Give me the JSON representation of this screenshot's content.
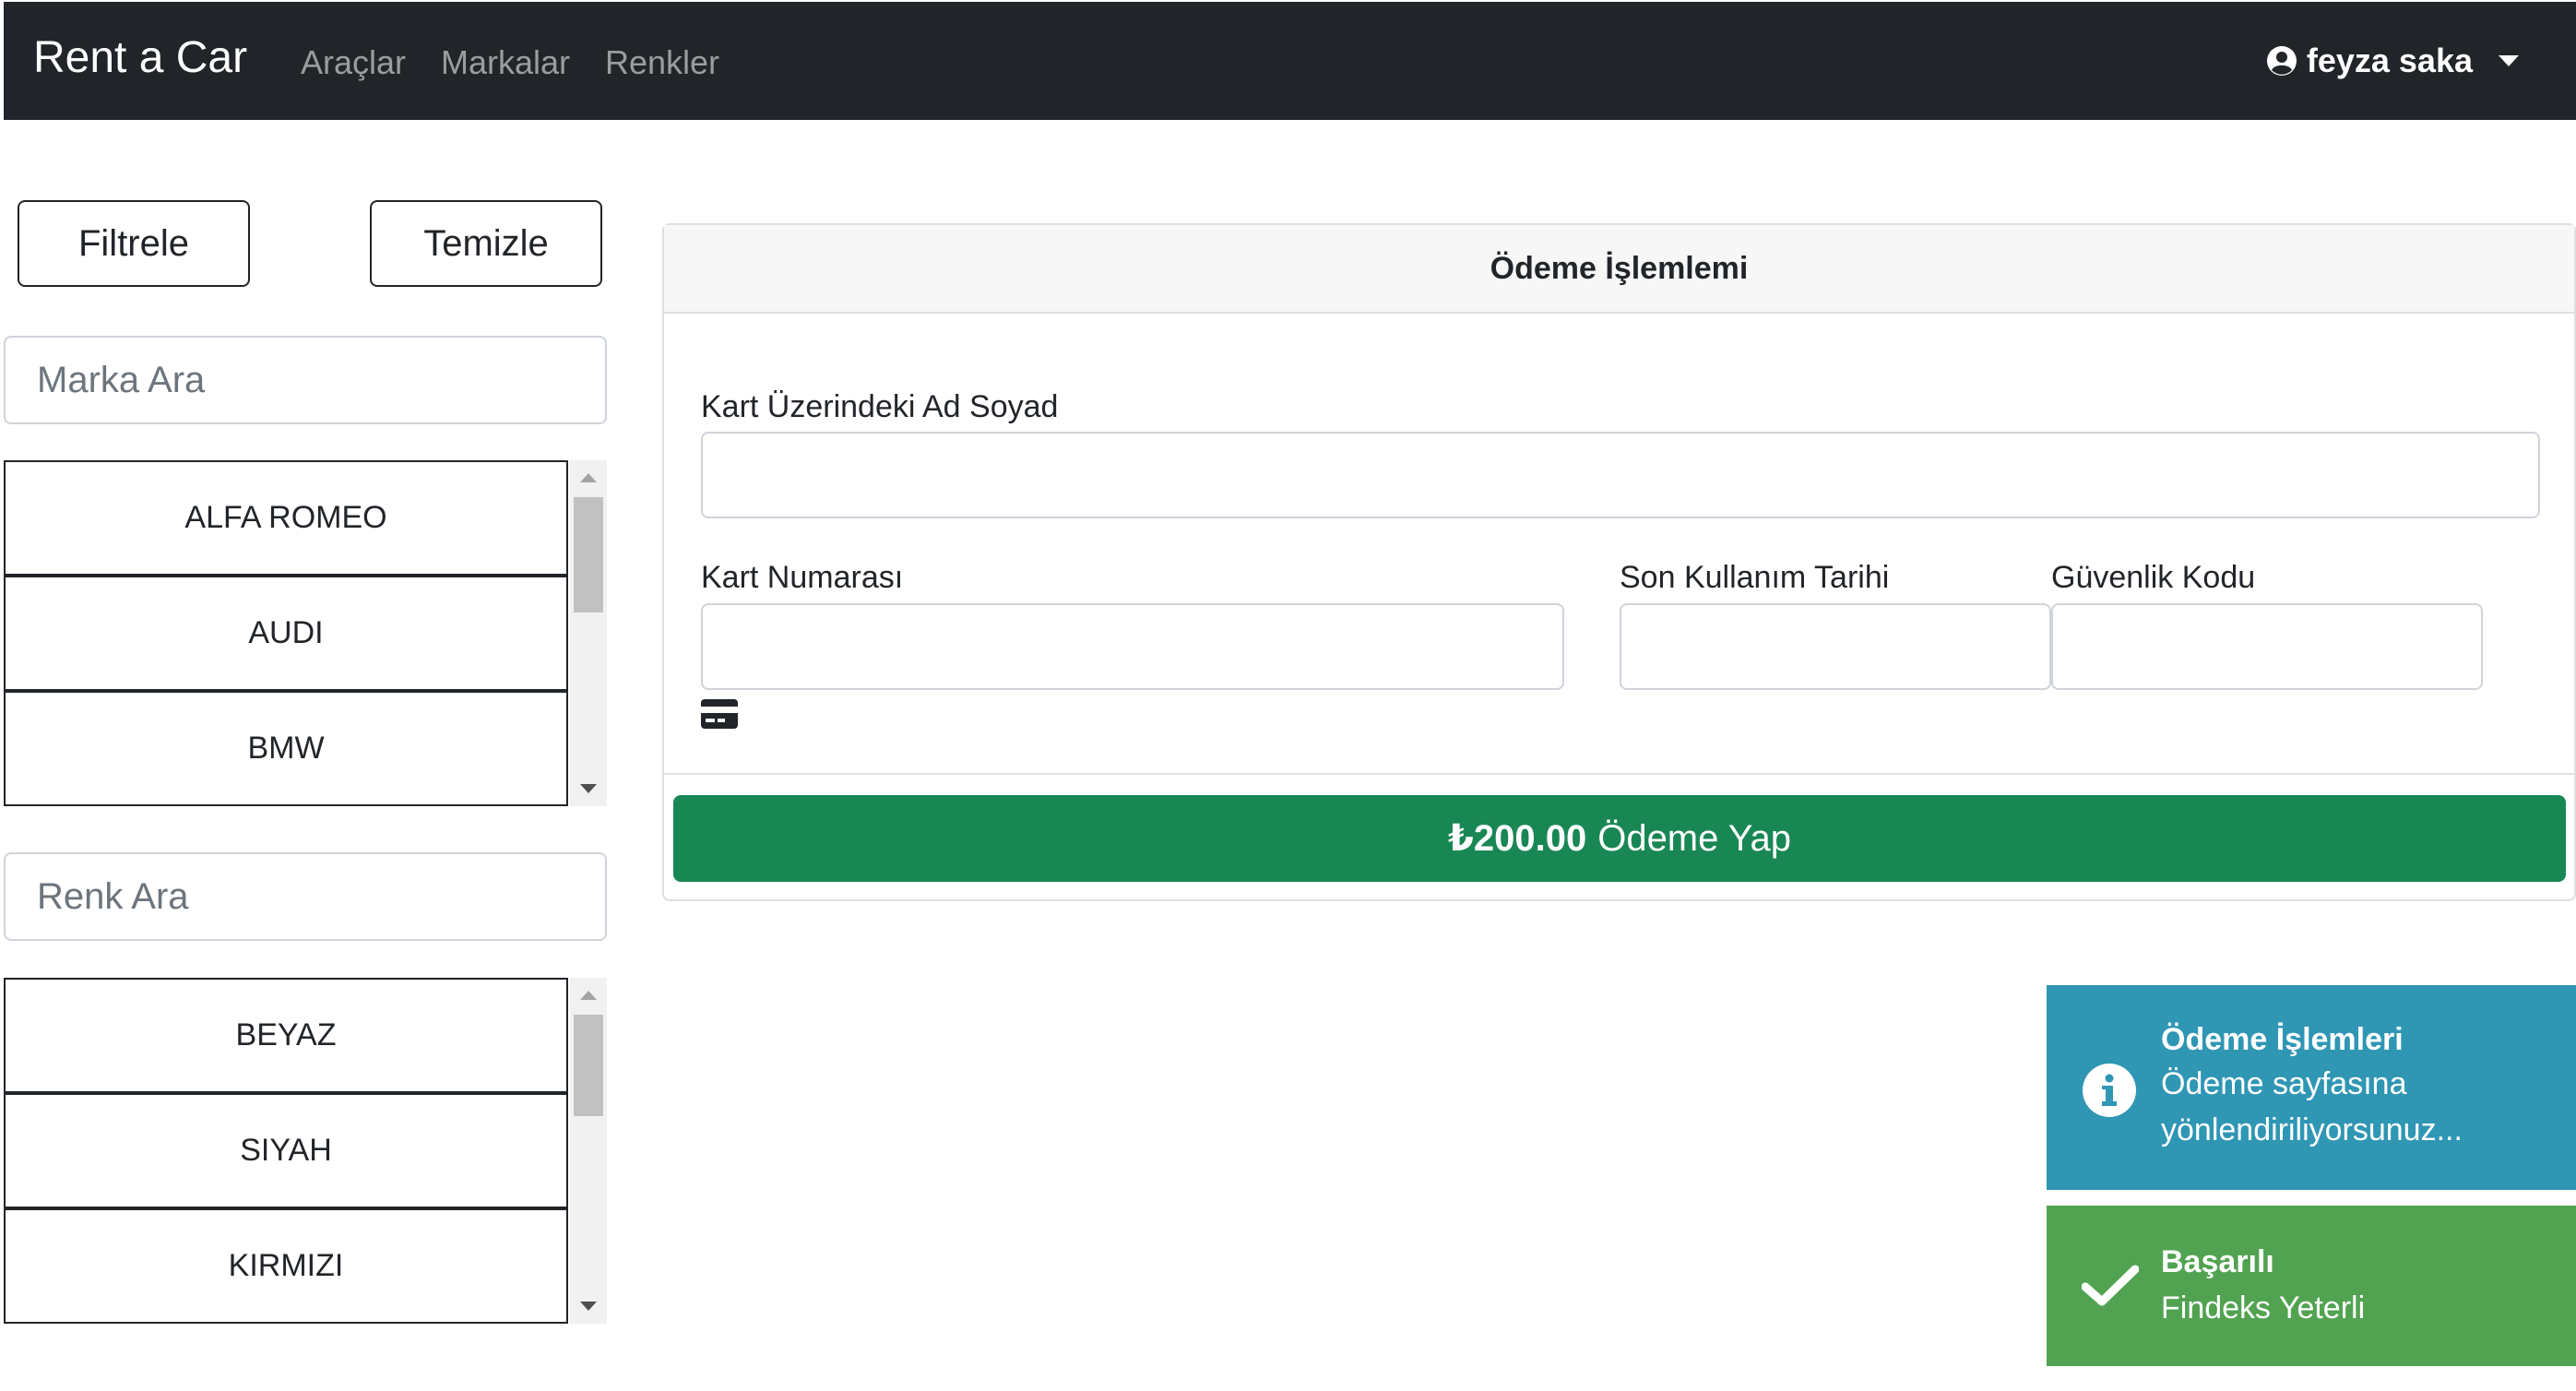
{
  "navbar": {
    "brand": "Rent a Car",
    "links": [
      "Araçlar",
      "Markalar",
      "Renkler"
    ],
    "user_name": "feyza saka"
  },
  "filters": {
    "filter_button": "Filtrele",
    "clear_button": "Temizle",
    "brand_search_placeholder": "Marka Ara",
    "brands": [
      "ALFA ROMEO",
      "AUDI",
      "BMW"
    ],
    "color_search_placeholder": "Renk Ara",
    "colors": [
      "BEYAZ",
      "SIYAH",
      "KIRMIZI"
    ]
  },
  "payment": {
    "header": "Ödeme İşlemlemi",
    "name_label": "Kart Üzerindeki Ad Soyad",
    "card_number_label": "Kart Numarası",
    "expiry_label": "Son Kullanım Tarihi",
    "cvv_label": "Güvenlik Kodu",
    "amount": "₺200.00",
    "pay_label": "Ödeme Yap"
  },
  "toasts": {
    "info_title": "Ödeme İşlemleri",
    "info_message": "Ödeme sayfasına yönlendiriliyorsunuz...",
    "success_title": "Başarılı",
    "success_message": "Findeks Yeterli"
  },
  "colors": {
    "navbar_bg": "#212529",
    "pay_button": "#198754",
    "toast_info": "#2f96b4",
    "toast_success": "#51a351"
  }
}
